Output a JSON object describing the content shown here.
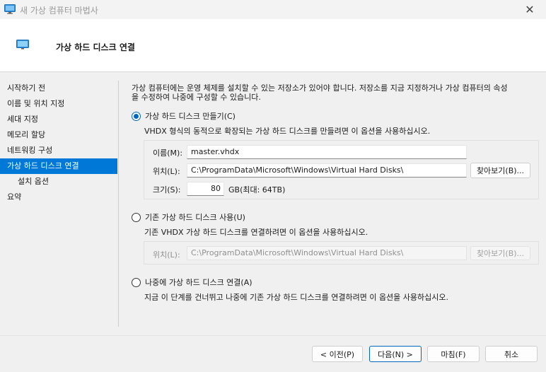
{
  "window": {
    "title": "새 가상 컴퓨터 마법사",
    "close_glyph": "✕"
  },
  "header": {
    "title": "가상 하드 디스크 연결"
  },
  "nav": {
    "items": [
      {
        "label": "시작하기 전",
        "active": false,
        "sub": false
      },
      {
        "label": "이름 및 위치 지정",
        "active": false,
        "sub": false
      },
      {
        "label": "세대 지정",
        "active": false,
        "sub": false
      },
      {
        "label": "메모리 할당",
        "active": false,
        "sub": false
      },
      {
        "label": "네트워킹 구성",
        "active": false,
        "sub": false
      },
      {
        "label": "가상 하드 디스크 연결",
        "active": true,
        "sub": false
      },
      {
        "label": "설치 옵션",
        "active": false,
        "sub": true
      },
      {
        "label": "요약",
        "active": false,
        "sub": false
      }
    ]
  },
  "intro": {
    "line1": "가상 컴퓨터에는 운영 체제를 설치할 수 있는 저장소가 있어야 합니다. 저장소를 지금 지정하거나 가상 컴퓨터의 속성",
    "line2": "을 수정하여 나중에 구성할 수 있습니다."
  },
  "option_create": {
    "label": "가상 하드 디스크 만들기(C)",
    "selected": true,
    "description": "VHDX 형식의 동적으로 확장되는 가상 하드 디스크를 만들려면 이 옵션을 사용하십시오.",
    "name_label": "이름(M):",
    "name_value": "master.vhdx",
    "location_label": "위치(L):",
    "location_value": "C:\\ProgramData\\Microsoft\\Windows\\Virtual Hard Disks\\",
    "browse_label": "찾아보기(B)...",
    "size_label": "크기(S):",
    "size_value": "80",
    "size_unit": "GB(최대: 64TB)"
  },
  "option_existing": {
    "label": "기존 가상 하드 디스크 사용(U)",
    "selected": false,
    "description": "기존 VHDX 가상 하드 디스크를 연결하려면 이 옵션을 사용하십시오.",
    "location_label": "위치(L):",
    "location_value": "C:\\ProgramData\\Microsoft\\Windows\\Virtual Hard Disks\\",
    "browse_label": "찾아보기(B)..."
  },
  "option_later": {
    "label": "나중에 가상 하드 디스크 연결(A)",
    "selected": false,
    "description": "지금 이 단계를 건너뛰고 나중에 기존 가상 하드 디스크를 연결하려면 이 옵션을 사용하십시오."
  },
  "footer": {
    "previous_label": "< 이전(P)",
    "next_label": "다음(N) >",
    "finish_label": "마침(F)",
    "cancel_label": "취소"
  },
  "colors": {
    "accent": "#0078d7",
    "radio_accent": "#0067c0"
  }
}
